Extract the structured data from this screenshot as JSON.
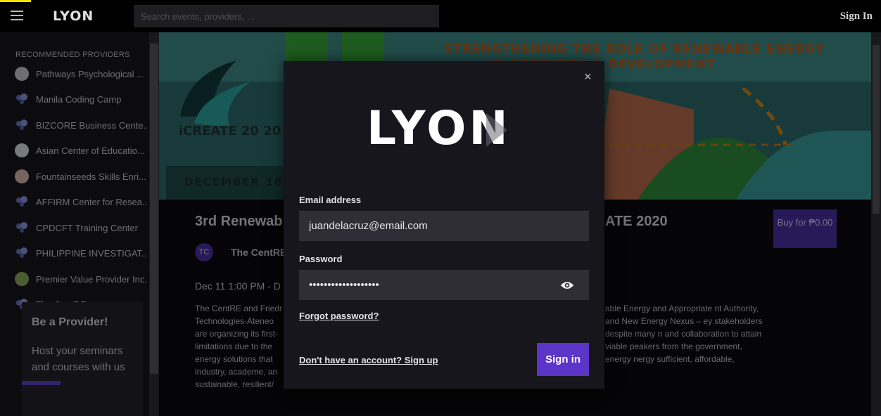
{
  "app": {
    "logo": "LYON"
  },
  "topbar": {
    "search_placeholder": "Search events, providers, ...",
    "sign_in": "Sign In"
  },
  "sidebar": {
    "heading": "RECOMMENDED PROVIDERS",
    "providers": [
      {
        "name": "Pathways Psychological ...",
        "icon": "provider-logo"
      },
      {
        "name": "Manila Coding Camp",
        "icon": "default-bubble"
      },
      {
        "name": "BIZCORE Business Cente...",
        "icon": "default-bubble"
      },
      {
        "name": "Asian Center of Educatio...",
        "icon": "provider-logo"
      },
      {
        "name": "Fountainseeds Skills Enri...",
        "icon": "provider-logo"
      },
      {
        "name": "AFFIRM Center for Resea...",
        "icon": "default-bubble"
      },
      {
        "name": "CPDCFT Training Center",
        "icon": "default-bubble"
      },
      {
        "name": "PHILIPPINE INVESTIGAT...",
        "icon": "default-bubble"
      },
      {
        "name": "Premier Value Provider Inc.",
        "icon": "pvp-logo"
      },
      {
        "name": "The CentRE",
        "icon": "default-bubble"
      }
    ],
    "provider_card": {
      "title": "Be a Provider!",
      "text": "Host your seminars and courses with us"
    }
  },
  "banner": {
    "tagline_1": "STRENGTHENING THE ROLE OF RENEWABLE ENERGY",
    "tagline_2": "IN RECOVERY & DEVELOPMENT",
    "create": "iCREATE 20 20",
    "date": "DECEMBER 18"
  },
  "event": {
    "title_left": "3rd Renewab",
    "title_right": "ATE 2020",
    "buy_label": "Buy for ₱0.00",
    "host_initials": "TC",
    "host_name": "The CentRE",
    "date": "Dec 11 1:00 PM - D",
    "desc_left": "The CentRE and Friedr Technologies-Ateneo are organizing its first- limitations due to the energy solutions that industry, academe, an sustainable, resilient/",
    "desc_right": "able Energy and Appropriate nt Authority, and New Energy Nexus – ey stakeholders despite many n and collaboration to attain viable peakers from the government, energy nergy sufficient, affordable,"
  },
  "modal": {
    "close": "×",
    "email_label": "Email address",
    "email_value": "juandelacruz@email.com",
    "password_label": "Password",
    "password_value": "juandelacruz1234567",
    "forgot": "Forgot password?",
    "signup": "Don't have an account? Sign up",
    "signin": "Sign in"
  },
  "colors": {
    "accent": "#5b35c7",
    "background": "#0e0e12",
    "modal_bg": "#17161c",
    "field_bg": "#2f2e36"
  }
}
